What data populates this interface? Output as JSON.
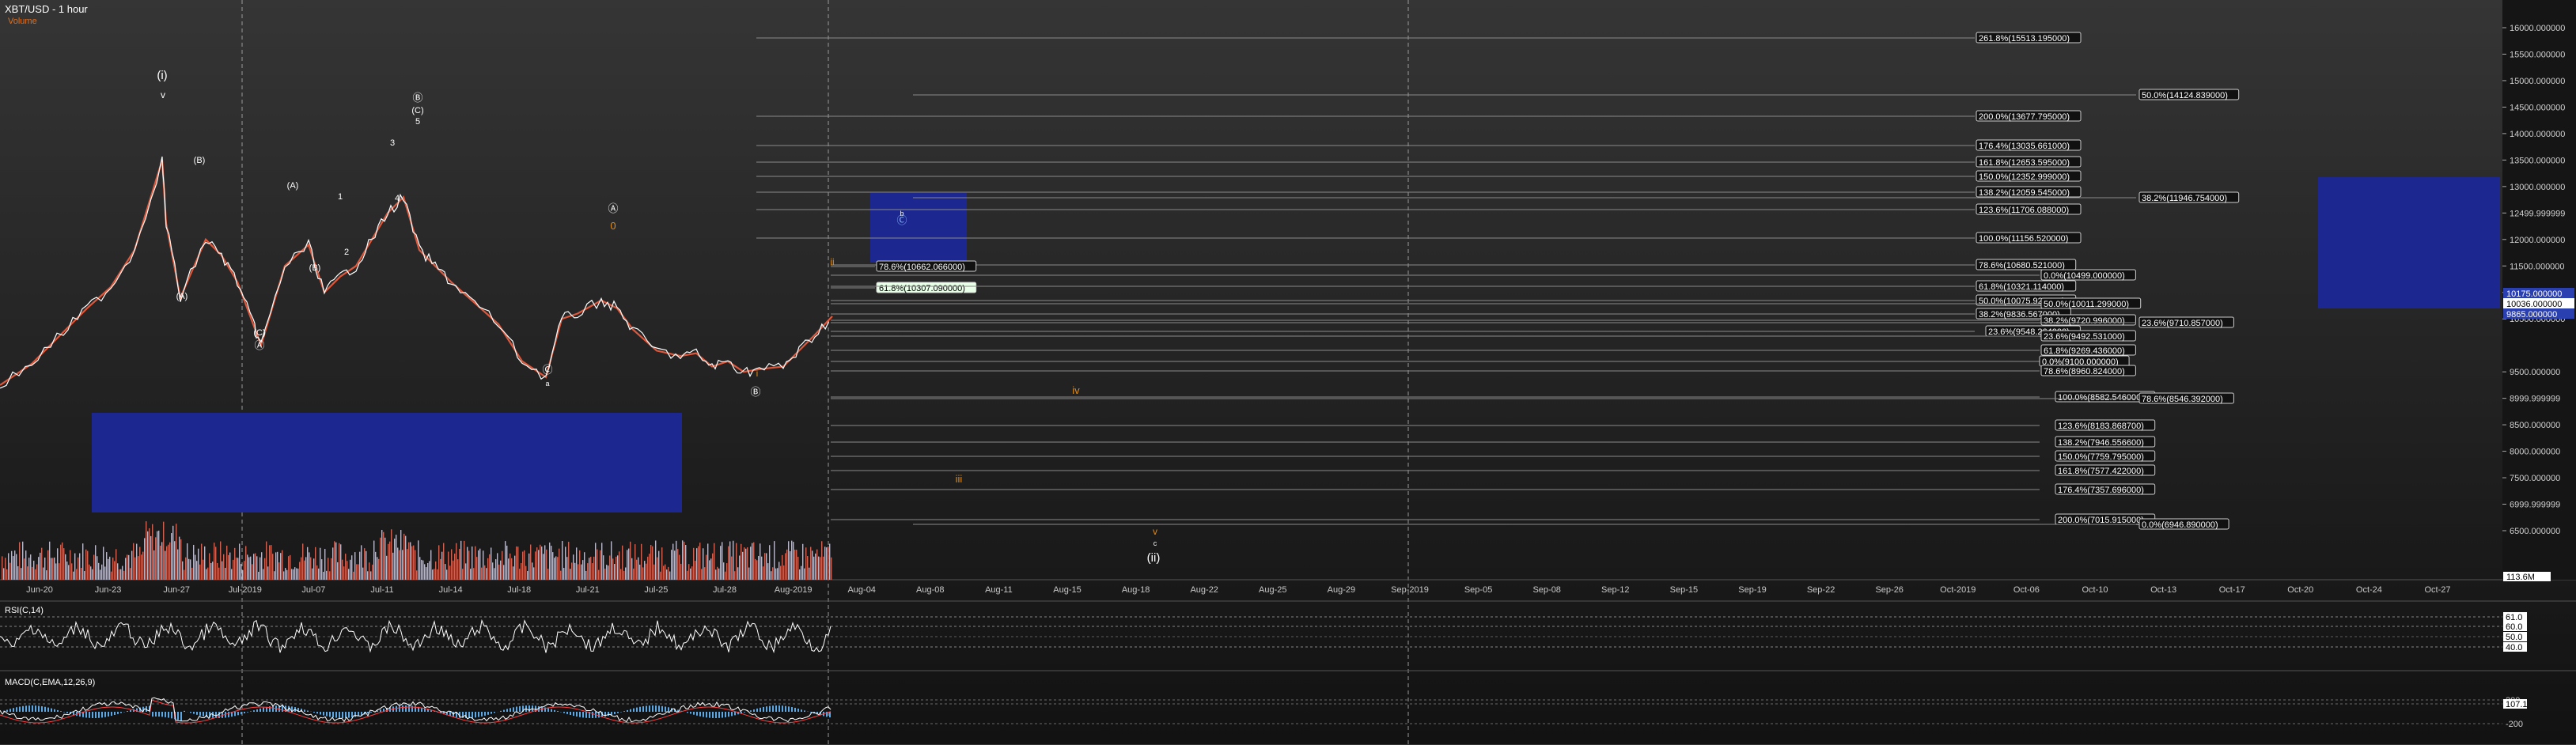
{
  "header": {
    "symbol": "XBT/USD - 1 hour",
    "volume_label": "Volume"
  },
  "colors": {
    "price_up": "#ffffff",
    "price_down": "#ff6040",
    "volume": "#d06050",
    "zone": "#1c2890",
    "fib_line": "#8a8a8a",
    "wave_orange": "#e08a1a",
    "rsi": "#ffffff",
    "macd": "#ffffff",
    "macd_signal": "#ff4040",
    "macd_hist": "#5aa8e8"
  },
  "chart_data": {
    "type": "line",
    "title": "XBT/USD - 1 hour",
    "x_ticks": [
      "Jun-20",
      "Jun-23",
      "Jun-27",
      "Jul-2019",
      "Jul-07",
      "Jul-11",
      "Jul-14",
      "Jul-18",
      "Jul-21",
      "Jul-25",
      "Jul-28",
      "Aug-2019",
      "Aug-04",
      "Aug-08",
      "Aug-11",
      "Aug-15",
      "Aug-18",
      "Aug-22",
      "Aug-25",
      "Aug-29",
      "Sep-2019",
      "Sep-05",
      "Sep-08",
      "Sep-12",
      "Sep-15",
      "Sep-19",
      "Sep-22",
      "Sep-26",
      "Oct-2019",
      "Oct-06",
      "Oct-10",
      "Oct-13",
      "Oct-17",
      "Oct-20",
      "Oct-24",
      "Oct-27"
    ],
    "y_ticks": [
      "16000.000000",
      "15500.000000",
      "15000.000000",
      "14500.000000",
      "14000.000000",
      "13500.000000",
      "13000.000000",
      "12499.999999",
      "12000.000000",
      "11500.000000",
      "11000.000000",
      "10500.000000",
      "9500.000000",
      "8999.999999",
      "8500.000000",
      "8000.000000",
      "7500.000000",
      "6999.999999",
      "6500.000000"
    ],
    "ylim": [
      6500,
      16000
    ],
    "price": [
      [
        "Jun-20",
        9250
      ],
      [
        "Jun-21",
        9650
      ],
      [
        "Jun-22",
        10250
      ],
      [
        "Jun-23",
        10700
      ],
      [
        "Jun-24",
        11100
      ],
      [
        "Jun-25",
        11800
      ],
      [
        "Jun-26",
        13500
      ],
      [
        "Jun-26b",
        12300
      ],
      [
        "Jun-27",
        10900
      ],
      [
        "Jun-28",
        12000
      ],
      [
        "Jun-29",
        11700
      ],
      [
        "Jun-30",
        11200
      ],
      [
        "Jul-01",
        10400
      ],
      [
        "Jul-02",
        10000
      ],
      [
        "Jul-03",
        11500
      ],
      [
        "Jul-04",
        11900
      ],
      [
        "Jul-05",
        11000
      ],
      [
        "Jul-06",
        11300
      ],
      [
        "Jul-07",
        11500
      ],
      [
        "Jul-08",
        12000
      ],
      [
        "Jul-09",
        12500
      ],
      [
        "Jul-10",
        12800
      ],
      [
        "Jul-11",
        11800
      ],
      [
        "Jul-12",
        11500
      ],
      [
        "Jul-13",
        11200
      ],
      [
        "Jul-14",
        10800
      ],
      [
        "Jul-15",
        10400
      ],
      [
        "Jul-16",
        9700
      ],
      [
        "Jul-17",
        9400
      ],
      [
        "Jul-18",
        10500
      ],
      [
        "Jul-19",
        10600
      ],
      [
        "Jul-20",
        10850
      ],
      [
        "Jul-21",
        10700
      ],
      [
        "Jul-22",
        10300
      ],
      [
        "Jul-23",
        9900
      ],
      [
        "Jul-24",
        9800
      ],
      [
        "Jul-25",
        9850
      ],
      [
        "Jul-26",
        9600
      ],
      [
        "Jul-27",
        9700
      ],
      [
        "Jul-28",
        9500
      ],
      [
        "Jul-29",
        9550
      ],
      [
        "Jul-30",
        9600
      ],
      [
        "Jul-31",
        9900
      ],
      [
        "Aug-01",
        10200
      ],
      [
        "Aug-02",
        10550
      ]
    ],
    "rsi": {
      "label": "RSI(C,14)",
      "levels": [
        "61.0",
        "60.0",
        "50.0",
        "40.0"
      ]
    },
    "macd": {
      "label": "MACD(C,EMA,12,26,9)",
      "levels": [
        "200",
        "107.1",
        "-200"
      ]
    },
    "volume_readout": "113.6M",
    "price_readouts": [
      "10175.000000",
      "10036.000000",
      "9865.000000"
    ]
  },
  "wave_labels": [
    {
      "text": "(i)"
    },
    {
      "text": "v"
    },
    {
      "text": "(A)"
    },
    {
      "text": "(B)"
    },
    {
      "text": "(C)"
    },
    {
      "text": "Ⓐ"
    },
    {
      "text": "(A)"
    },
    {
      "text": "(B)"
    },
    {
      "text": "1"
    },
    {
      "text": "2"
    },
    {
      "text": "3"
    },
    {
      "text": "4"
    },
    {
      "text": "Ⓑ"
    },
    {
      "text": "(C)"
    },
    {
      "text": "5"
    },
    {
      "text": "Ⓒ"
    },
    {
      "text": "a"
    },
    {
      "text": "Ⓐ"
    },
    {
      "text": "0"
    },
    {
      "text": "i"
    },
    {
      "text": "Ⓑ"
    },
    {
      "text": "ii"
    },
    {
      "text": "iv"
    },
    {
      "text": "iii"
    },
    {
      "text": "v"
    },
    {
      "text": "c"
    },
    {
      "text": "(ii)"
    },
    {
      "text": "b"
    },
    {
      "text": "Ⓒ"
    }
  ],
  "fib_labels": [
    {
      "text": "261.8%(15513.195000)"
    },
    {
      "text": "50.0%(14124.839000)"
    },
    {
      "text": "200.0%(13677.795000)"
    },
    {
      "text": "176.4%(13035.661000)"
    },
    {
      "text": "161.8%(12653.595000)"
    },
    {
      "text": "150.0%(12352.999000)"
    },
    {
      "text": "138.2%(12059.545000)"
    },
    {
      "text": "38.2%(11946.754000)"
    },
    {
      "text": "123.6%(11706.088000)"
    },
    {
      "text": "100.0%(11156.520000)"
    },
    {
      "text": "78.6%(10680.521000)"
    },
    {
      "text": "78.6%(10662.066000)"
    },
    {
      "text": "0.0%(10499.000000)"
    },
    {
      "text": "61.8%(10307.090000)"
    },
    {
      "text": "61.8%(10321.114000)"
    },
    {
      "text": "50.0%(10075.929000)"
    },
    {
      "text": "50.0%(10011.299000)"
    },
    {
      "text": "38.2%(9836.567000)"
    },
    {
      "text": "38.2%(9720.996000)"
    },
    {
      "text": "23.6%(9710.857000)"
    },
    {
      "text": "23.6%(9548.264000)"
    },
    {
      "text": "23.6%(9492.531000)"
    },
    {
      "text": "61.8%(9269.436000)"
    },
    {
      "text": "0.0%(9100.000000)"
    },
    {
      "text": "78.6%(8960.824000)"
    },
    {
      "text": "100.0%(8582.546000)"
    },
    {
      "text": "78.6%(8546.392000)"
    },
    {
      "text": "123.6%(8183.868700)"
    },
    {
      "text": "138.2%(7946.556600)"
    },
    {
      "text": "150.0%(7759.795000)"
    },
    {
      "text": "161.8%(7577.422000)"
    },
    {
      "text": "176.4%(7357.696000)"
    },
    {
      "text": "200.0%(7015.915000)"
    },
    {
      "text": "0.0%(6946.890000)"
    }
  ]
}
